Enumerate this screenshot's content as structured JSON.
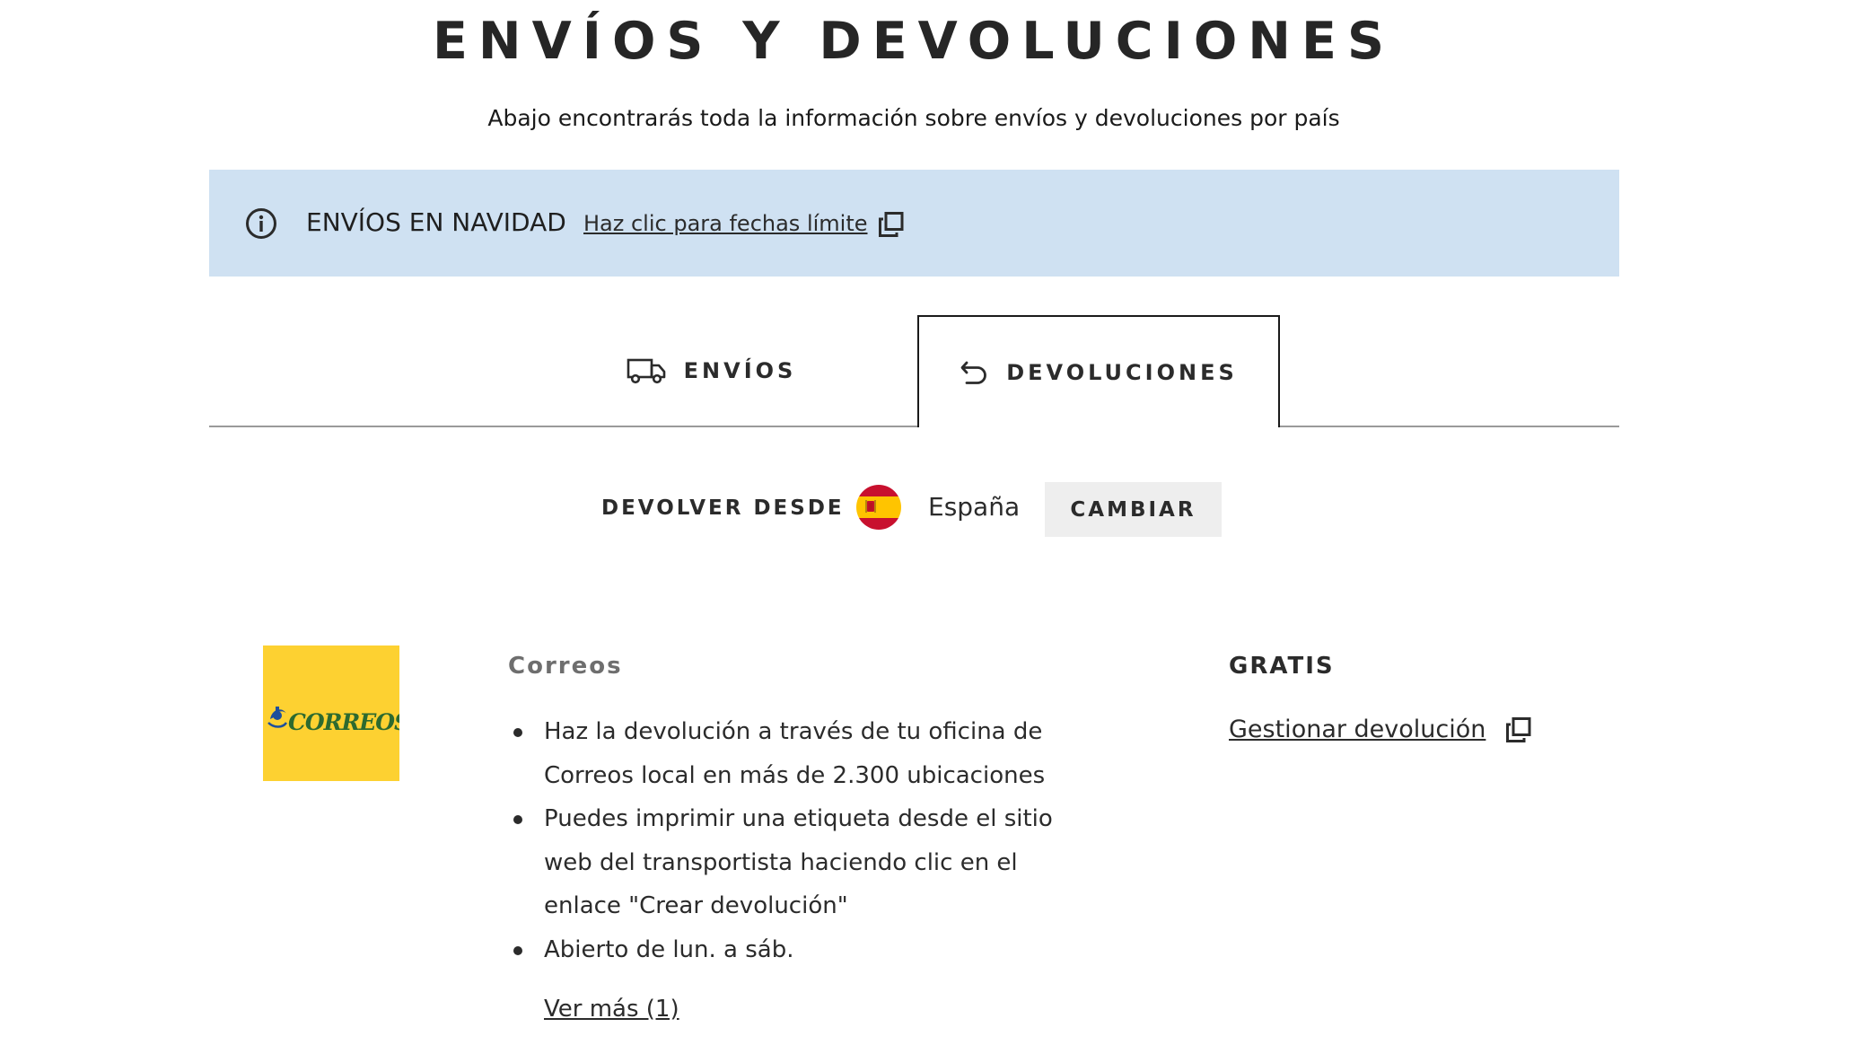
{
  "header": {
    "title": "ENVÍOS Y DEVOLUCIONES",
    "subtitle": "Abajo encontrarás toda la información sobre envíos y devoluciones por país"
  },
  "notice": {
    "title": "ENVÍOS EN NAVIDAD",
    "link_label": "Haz clic para fechas límite",
    "info_icon": "info-icon",
    "external_icon": "external-link-icon",
    "background_color": "#cfe1f2"
  },
  "tabs": [
    {
      "label": "ENVÍOS",
      "icon": "truck-icon",
      "active": false
    },
    {
      "label": "DEVOLUCIONES",
      "icon": "return-arrow-icon",
      "active": true
    }
  ],
  "country": {
    "label": "DEVOLVER DESDE",
    "name": "España",
    "flag_icon": "spain-flag-icon",
    "change_label": "CAMBIAR"
  },
  "carrier": {
    "logo_text": "CORREOS",
    "logo_color": "#fdd131",
    "name": "Correos",
    "bullets": [
      "Haz la devolución a través de tu oficina de Correos local en más de 2.300 ubicaciones",
      "Puedes imprimir una etiqueta desde el sitio web del transportista haciendo clic en el enlace \"Crear devolución\"",
      "Abierto de lun. a sáb."
    ],
    "see_more_label": "Ver más (1)",
    "price": "GRATIS",
    "manage_label": "Gestionar devolución"
  }
}
